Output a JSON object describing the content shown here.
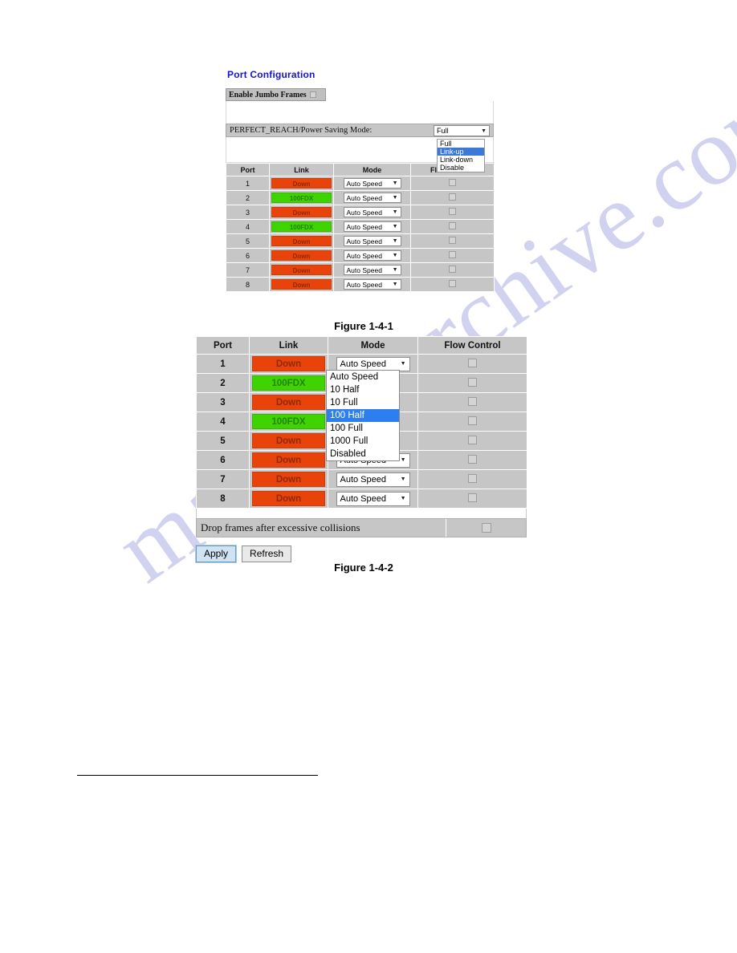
{
  "watermark": {
    "text": "manualsarchive.com"
  },
  "figure1": {
    "title": "Port Configuration",
    "jumbo": {
      "label": "Enable Jumbo Frames",
      "checked": false
    },
    "power_saving": {
      "label": "PERFECT_REACH/Power Saving Mode:",
      "selected": "Full",
      "options": [
        "Full",
        "Link-up",
        "Link-down",
        "Disable"
      ],
      "highlighted": "Link-up"
    },
    "table": {
      "headers": [
        "Port",
        "Link",
        "Mode",
        "Flow Control"
      ],
      "rows": [
        {
          "port": "1",
          "link": "Down",
          "link_state": "down",
          "mode": "Auto Speed",
          "flow_control": false
        },
        {
          "port": "2",
          "link": "100FDX",
          "link_state": "up",
          "mode": "Auto Speed",
          "flow_control": false
        },
        {
          "port": "3",
          "link": "Down",
          "link_state": "down",
          "mode": "Auto Speed",
          "flow_control": false
        },
        {
          "port": "4",
          "link": "100FDX",
          "link_state": "up",
          "mode": "Auto Speed",
          "flow_control": false
        },
        {
          "port": "5",
          "link": "Down",
          "link_state": "down",
          "mode": "Auto Speed",
          "flow_control": false
        },
        {
          "port": "6",
          "link": "Down",
          "link_state": "down",
          "mode": "Auto Speed",
          "flow_control": false
        },
        {
          "port": "7",
          "link": "Down",
          "link_state": "down",
          "mode": "Auto Speed",
          "flow_control": false
        },
        {
          "port": "8",
          "link": "Down",
          "link_state": "down",
          "mode": "Auto Speed",
          "flow_control": false
        }
      ]
    },
    "caption": "Figure 1-4-1"
  },
  "figure2": {
    "table": {
      "headers": [
        "Port",
        "Link",
        "Mode",
        "Flow Control"
      ],
      "rows": [
        {
          "port": "1",
          "link": "Down",
          "link_state": "down",
          "mode": "Auto Speed",
          "flow_control": false
        },
        {
          "port": "2",
          "link": "100FDX",
          "link_state": "up",
          "mode": "Auto Speed",
          "flow_control": false
        },
        {
          "port": "3",
          "link": "Down",
          "link_state": "down",
          "mode": "Auto Speed",
          "flow_control": false
        },
        {
          "port": "4",
          "link": "100FDX",
          "link_state": "up",
          "mode": "Auto Speed",
          "flow_control": false
        },
        {
          "port": "5",
          "link": "Down",
          "link_state": "down",
          "mode": "Auto Speed",
          "flow_control": false
        },
        {
          "port": "6",
          "link": "Down",
          "link_state": "down",
          "mode": "Auto Speed",
          "flow_control": false
        },
        {
          "port": "7",
          "link": "Down",
          "link_state": "down",
          "mode": "Auto Speed",
          "flow_control": false
        },
        {
          "port": "8",
          "link": "Down",
          "link_state": "down",
          "mode": "Auto Speed",
          "flow_control": false
        }
      ]
    },
    "mode_dropdown": {
      "open_for_port": "1",
      "selected": "Auto Speed",
      "highlighted": "100 Half",
      "options": [
        "Auto Speed",
        "10 Half",
        "10 Full",
        "100 Half",
        "100 Full",
        "1000 Full",
        "Disabled"
      ]
    },
    "drop_frames": {
      "label": "Drop frames after excessive collisions",
      "checked": false
    },
    "buttons": {
      "apply": "Apply",
      "refresh": "Refresh"
    },
    "caption": "Figure 1-4-2"
  },
  "colors": {
    "link_down": "#e8430b",
    "link_up": "#3fd300",
    "header_blue": "#1414c8",
    "select_highlight": "#2d7ff0",
    "panel_gray": "#c6c6c6"
  }
}
